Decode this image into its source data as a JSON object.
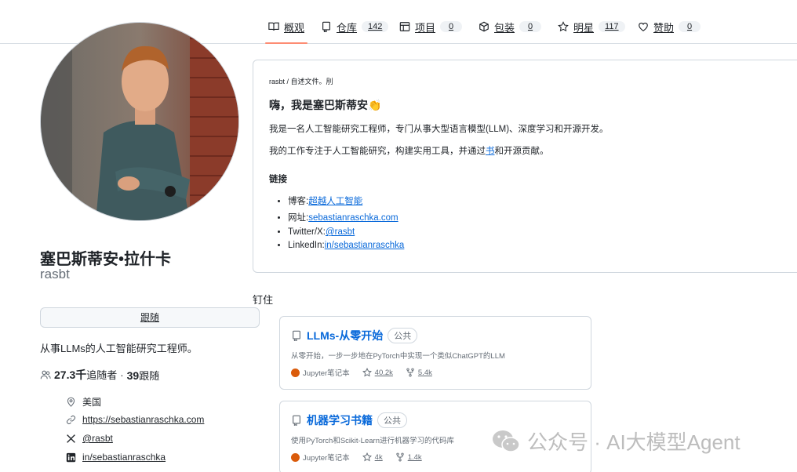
{
  "nav": {
    "tabs": [
      {
        "label": "概观",
        "count": ""
      },
      {
        "label": "仓库",
        "count": "142"
      },
      {
        "label": "项目",
        "count": "0"
      },
      {
        "label": "包装",
        "count": "0"
      },
      {
        "label": "明星",
        "count": "117"
      },
      {
        "label": "赞助",
        "count": "0"
      }
    ],
    "accent_color": "#fd8c73"
  },
  "profile": {
    "name": "塞巴斯蒂安•拉什卡",
    "login": "rasbt",
    "follow_label": "跟随",
    "bio": "从事LLMs的人工智能研究工程师。",
    "followers_count": "27.3千",
    "followers_label": "追随者",
    "separator": "·",
    "following_count": "39",
    "following_label": "跟随",
    "location": "美国",
    "website": "https://sebastianraschka.com",
    "twitter": "@rasbt",
    "linkedin": "in/sebastianraschka"
  },
  "readme": {
    "path": "rasbt / 自述文件。刖",
    "title": "嗨，我是塞巴斯蒂安👏",
    "para1": "我是一名人工智能研究工程师，专门从事大型语言模型(LLM)、深度学习和开源开发。",
    "para2_before": "我的工作专注于人工智能研究，构建实用工具，并通过",
    "para2_link": "书",
    "para2_after": "和开源贡献。",
    "links_heading": "链接",
    "links": [
      {
        "prefix": "博客:",
        "link": "超越人工智能"
      },
      {
        "prefix": "网址:",
        "link": "sebastianraschka.com"
      },
      {
        "prefix": "Twitter/X:",
        "link": "@rasbt"
      },
      {
        "prefix": "LinkedIn:",
        "link": "in/sebastianraschka"
      }
    ]
  },
  "pinned": {
    "title": "钉住",
    "repos": [
      {
        "name": "LLMs-从零开始",
        "visibility": "公共",
        "description": "从零开始，一步一步地在PyTorch中实现一个类似ChatGPT的LLM",
        "language": "Jupyter笔记本",
        "language_color": "#da5b0b",
        "stars": "40.2k",
        "forks": "5.4k"
      },
      {
        "name": "机器学习书籍",
        "visibility": "公共",
        "description": "使用PyTorch和Scikit-Learn进行机器学习的代码库",
        "language": "Jupyter笔记本",
        "language_color": "#da5b0b",
        "stars": "4k",
        "forks": "1.4k"
      }
    ]
  },
  "watermark": {
    "text": "公众号 · AI大模型Agent"
  }
}
